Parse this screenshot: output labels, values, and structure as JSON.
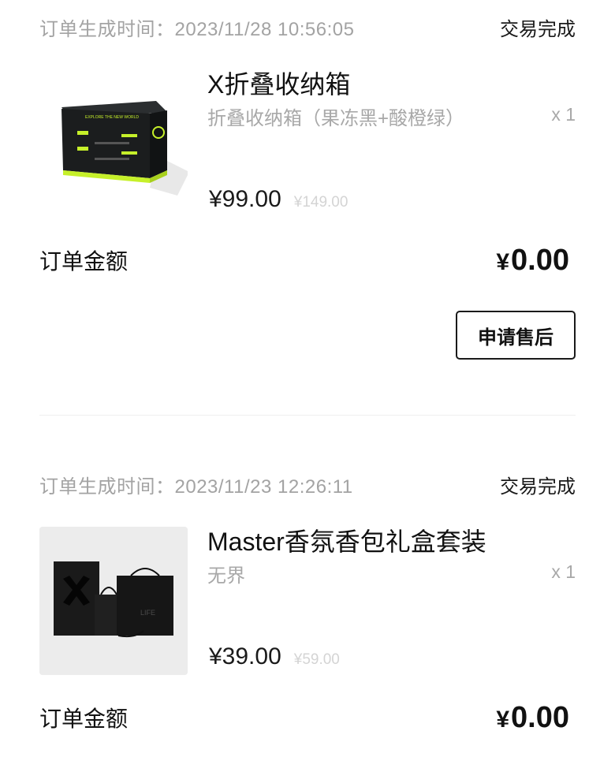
{
  "orders": [
    {
      "time_label": "订单生成时间：",
      "time": "2023/11/28 10:56:05",
      "status": "交易完成",
      "product": {
        "name": "X折叠收纳箱",
        "spec": "折叠收纳箱（果冻黑+酸橙绿）",
        "qty": "x 1",
        "price": "¥99.00",
        "original_price": "¥149.00",
        "image_text": "EXPLORE THE NEW WORLD"
      },
      "total_label": "订单金额",
      "total_currency": "¥",
      "total_value": "0.00",
      "aftersale_button": "申请售后"
    },
    {
      "time_label": "订单生成时间：",
      "time": "2023/11/23 12:26:11",
      "status": "交易完成",
      "product": {
        "name": "Master香氛香包礼盒套装",
        "spec": "无界",
        "qty": "x 1",
        "price": "¥39.00",
        "original_price": "¥59.00",
        "image_text": "LIFE"
      },
      "total_label": "订单金额",
      "total_currency": "¥",
      "total_value": "0.00"
    }
  ],
  "colors": {
    "accent_lime": "#c6f02a",
    "box_black": "#1b1d1e",
    "muted_text": "#a8a8a8"
  }
}
